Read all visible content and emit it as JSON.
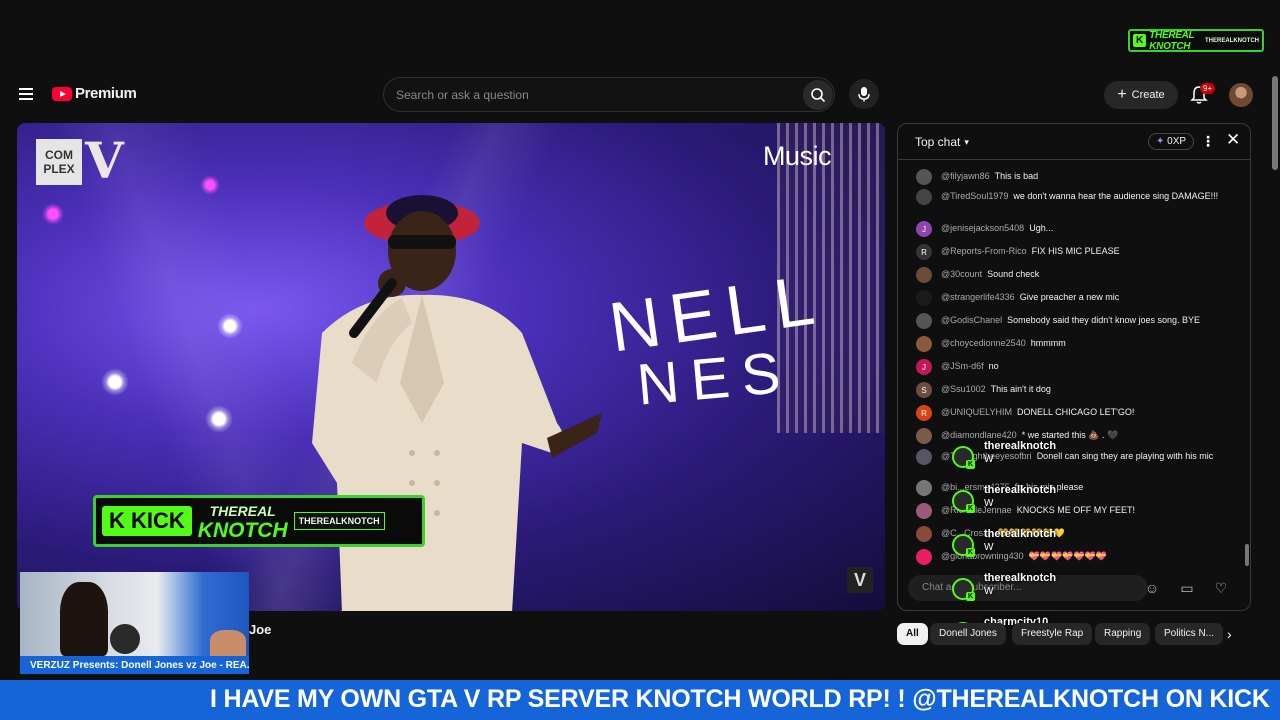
{
  "brand": {
    "logo_text": "Premium",
    "kick_corner": {
      "k": "K",
      "title": "THEREAL KNOTCH",
      "sub": "THEREALKNOTCH"
    }
  },
  "search": {
    "placeholder": "Search or ask a question"
  },
  "header": {
    "create_label": "Create",
    "notif_badge": "9+"
  },
  "video": {
    "complex_logo": "COM PLEX",
    "verzuz_mark": "V",
    "apple_music": "Music",
    "stage_line1": "NELL",
    "stage_line2": "NES",
    "watermark": "V",
    "kick_overlay": {
      "k": "K KICK",
      "title_top": "THEREAL",
      "title_main": "KNOTCH",
      "channel": "THEREALKNOTCH"
    }
  },
  "below_video": {
    "title_fragment": "Joe",
    "webcam_caption": "VERZUZ Presents: Donell Jones vz Joe - REA..."
  },
  "chat": {
    "header": "Top chat",
    "xp": "0XP",
    "input_placeholder": "Chat as a subscriber...",
    "messages": [
      {
        "name": "@filyjawn86",
        "text": "This is bad",
        "initial": "",
        "color": "#555"
      },
      {
        "name": "@TiredSoul1979",
        "text": "we don't wanna hear the audience sing DAMAGE!!!",
        "initial": "",
        "color": "#444"
      },
      {
        "name": "@jenisejackson5408",
        "text": "Ugh...",
        "initial": "J",
        "color": "#8e44ad"
      },
      {
        "name": "@Reports-From-Rico",
        "text": "FIX HIS MIC PLEASE",
        "initial": "R",
        "color": "#333"
      },
      {
        "name": "@30count",
        "text": "Sound check",
        "initial": "",
        "color": "#6b4b3a"
      },
      {
        "name": "@strangerlife4336",
        "text": "Give preacher a new mic",
        "initial": "",
        "color": "#1b1b1b"
      },
      {
        "name": "@GodisChanel",
        "text": "Somebody said they didn't know joes song. BYE",
        "initial": "",
        "color": "#555"
      },
      {
        "name": "@choycedionne2540",
        "text": "hmmmm",
        "initial": "",
        "color": "#8a5a3a"
      },
      {
        "name": "@JSm-d6f",
        "text": "no",
        "initial": "J",
        "color": "#c2185b"
      },
      {
        "name": "@Ssu1002",
        "text": "This ain't it dog",
        "initial": "S",
        "color": "#6d4c41"
      },
      {
        "name": "@UNIQUELYHIM",
        "text": "DONELL CHICAGO LET'GO!",
        "initial": "R",
        "color": "#d84315"
      },
      {
        "name": "@diamondlane420",
        "text": "* we started this 💩 . 🖤",
        "initial": "",
        "color": "#7b5b4b"
      },
      {
        "name": "@Thr...ightheeyesofbri",
        "text": "Donell can sing they are playing with his mic",
        "initial": "",
        "color": "#556"
      },
      {
        "name": "@bi...ersmo4275",
        "text": "fix his mic please",
        "initial": "",
        "color": "#777"
      },
      {
        "name": "@RichelleJennae",
        "text": "KNOCKS ME OFF MY FEET!",
        "initial": "",
        "color": "#9a5a7a"
      },
      {
        "name": "@C...Crosby",
        "text": "💛💛💛💛💛💛",
        "initial": "",
        "color": "#8a4a3a"
      },
      {
        "name": "@gloriabrowning430",
        "text": "💝💝💝💝💝💝💝",
        "initial": "",
        "color": "#e91e63"
      }
    ],
    "overlay": [
      {
        "name": "therealknotch",
        "text": "W"
      },
      {
        "name": "therealknotch",
        "text": "W"
      },
      {
        "name": "therealknotch",
        "text": "W"
      },
      {
        "name": "therealknotch",
        "text": "W"
      },
      {
        "name": "charmcity10",
        "text": ""
      }
    ]
  },
  "chips": [
    "All",
    "Donell Jones",
    "Freestyle Rap",
    "Rapping",
    "Politics N..."
  ],
  "ticker": {
    "text": "I HAVE MY OWN GTA V RP SERVER KNOTCH WORLD RP! ! @THEREALKNOTCH ON KICK"
  },
  "colors": {
    "accent_red": "#ff0033",
    "kick_green": "#53fc18",
    "ticker_blue": "#1565d8"
  }
}
